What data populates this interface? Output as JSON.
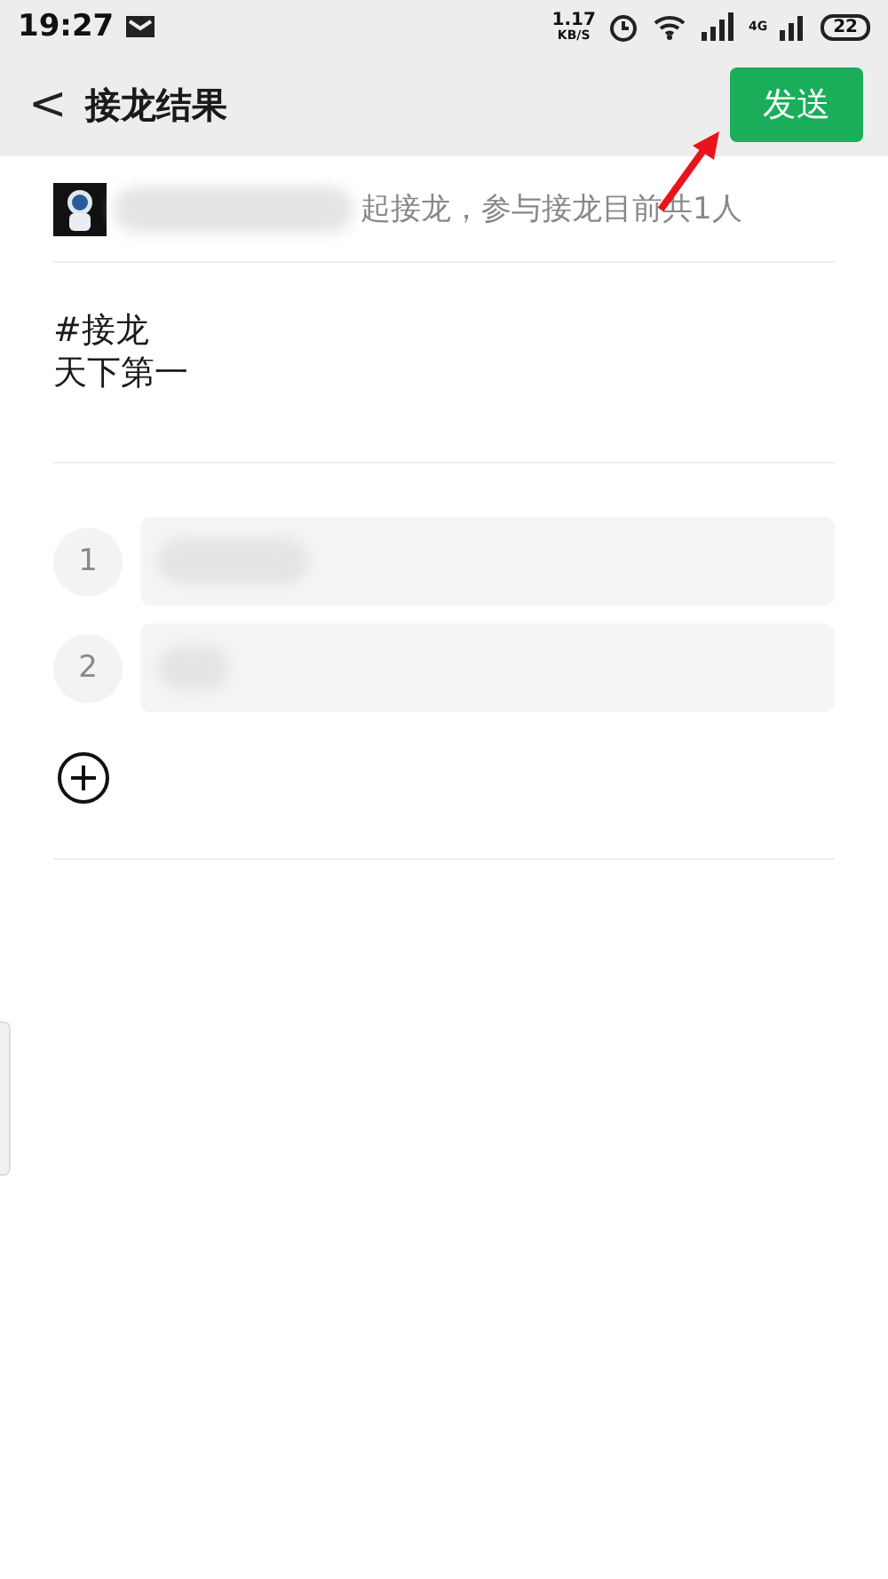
{
  "status_bar": {
    "time": "19:27",
    "speed_value": "1.17",
    "speed_unit": "KB/S",
    "network": "4G",
    "battery": "22"
  },
  "header": {
    "back": "<",
    "title": "接龙结果",
    "send_button": "发送"
  },
  "info": {
    "text": "起接龙，参与接龙目前共1人"
  },
  "topic": {
    "lines": [
      "#接龙",
      "天下第一"
    ]
  },
  "entries": [
    {
      "index": "1"
    },
    {
      "index": "2"
    }
  ]
}
